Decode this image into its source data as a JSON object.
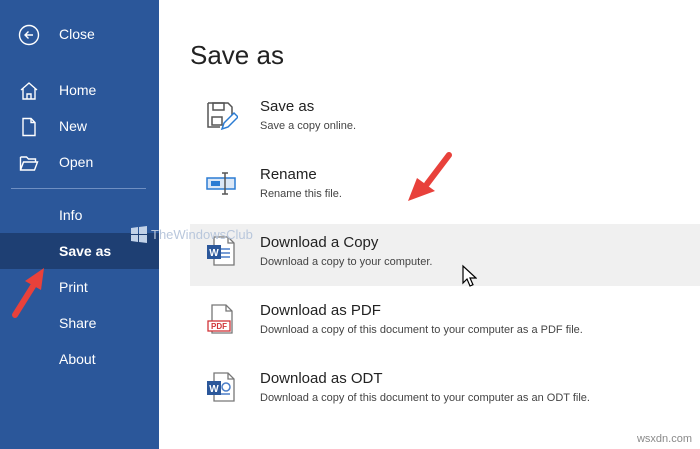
{
  "sidebar": {
    "items": [
      {
        "label": "Close",
        "icon": "back-arrow-icon"
      },
      {
        "label": "Home",
        "icon": "home-icon"
      },
      {
        "label": "New",
        "icon": "new-document-icon"
      },
      {
        "label": "Open",
        "icon": "folder-open-icon"
      },
      {
        "label": "Info"
      },
      {
        "label": "Save as",
        "selected": true
      },
      {
        "label": "Print"
      },
      {
        "label": "Share"
      },
      {
        "label": "About"
      }
    ]
  },
  "main": {
    "title": "Save as",
    "options": [
      {
        "title": "Save as",
        "description": "Save a copy online.",
        "icon": "save-as-icon"
      },
      {
        "title": "Rename",
        "description": "Rename this file.",
        "icon": "rename-icon"
      },
      {
        "title": "Download a Copy",
        "description": "Download a copy to your computer.",
        "icon": "word-document-icon",
        "hovered": true
      },
      {
        "title": "Download as PDF",
        "description": "Download a copy of this document to your computer as a PDF file.",
        "icon": "pdf-icon"
      },
      {
        "title": "Download as ODT",
        "description": "Download a copy of this document to your computer as an ODT file.",
        "icon": "odt-document-icon"
      }
    ]
  },
  "watermark": {
    "text": "TheWindowsClub"
  },
  "site_watermark": {
    "text": "wsxdn.com"
  },
  "colors": {
    "sidebar": "#2b579a",
    "sidebar_selected": "#1e3f73",
    "annotation_arrow": "#e8413b",
    "hover_row": "#f0f0f0"
  }
}
